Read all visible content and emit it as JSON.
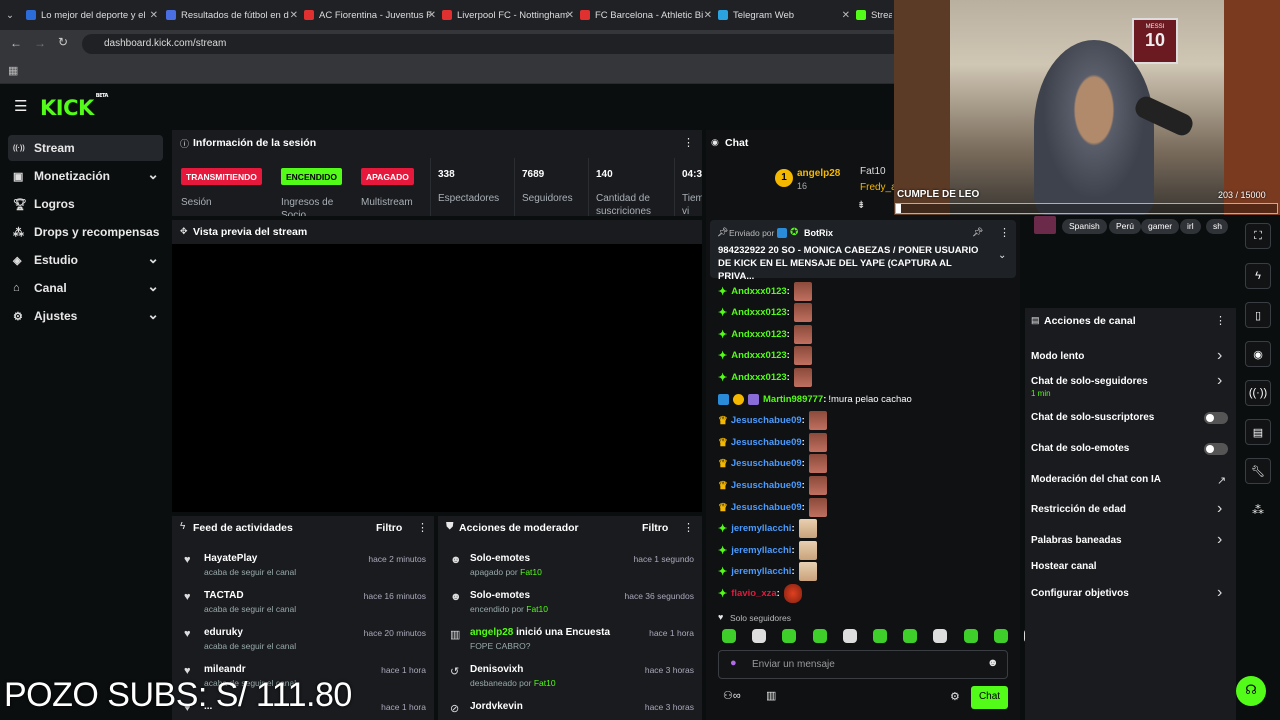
{
  "browser": {
    "tabs": [
      {
        "title": "Lo mejor del deporte y el",
        "color": "#2b6cd8"
      },
      {
        "title": "Resultados de fútbol en d",
        "color": "#4a6fe3"
      },
      {
        "title": "AC Fiorentina - Juventus F",
        "color": "#e03030"
      },
      {
        "title": "Liverpool FC - Nottingham",
        "color": "#e03030"
      },
      {
        "title": "FC Barcelona - Athletic Bi",
        "color": "#e03030"
      },
      {
        "title": "Telegram Web",
        "color": "#2aa3e0"
      },
      {
        "title": "Strea",
        "color": "#53fc18"
      }
    ],
    "url": "dashboard.kick.com/stream"
  },
  "logo": {
    "text": "KICK",
    "tag": "BETA"
  },
  "sidebar": {
    "items": [
      {
        "label": "Stream",
        "icon": "broadcast-icon",
        "active": true,
        "chevron": false
      },
      {
        "label": "Monetización",
        "icon": "monetization-icon",
        "chevron": true
      },
      {
        "label": "Logros",
        "icon": "trophy-icon",
        "chevron": false
      },
      {
        "label": "Drops y recompensas",
        "icon": "drops-icon",
        "chevron": false
      },
      {
        "label": "Estudio",
        "icon": "studio-icon",
        "chevron": true
      },
      {
        "label": "Canal",
        "icon": "channel-icon",
        "chevron": true
      },
      {
        "label": "Ajustes",
        "icon": "gear-icon",
        "chevron": true
      }
    ]
  },
  "session": {
    "title": "Información de la sesión",
    "badges": [
      {
        "text": "TRANSMITIENDO",
        "label": "Sesión",
        "color": "#e6183c"
      },
      {
        "text": "ENCENDIDO",
        "label": "Ingresos de Socio",
        "color": "#53fc18"
      },
      {
        "text": "APAGADO",
        "label": "Multistream",
        "color": "#e6183c"
      }
    ],
    "stats": [
      {
        "value": "338",
        "label": "Espectadores"
      },
      {
        "value": "7689",
        "label": "Seguidores"
      },
      {
        "value": "140",
        "label": "Cantidad de suscriciones"
      },
      {
        "value": "04:3",
        "label": "Tiem vi"
      }
    ]
  },
  "preview": {
    "title": "Vista previa del stream"
  },
  "activity": {
    "title": "Feed de actividades",
    "filter": "Filtro",
    "rows": [
      {
        "name": "HayatePlay",
        "sub": "acaba de seguir el canal",
        "time": "hace 2 minutos"
      },
      {
        "name": "TACTAD",
        "sub": "acaba de seguir el canal",
        "time": "hace 16 minutos"
      },
      {
        "name": "eduruky",
        "sub": "acaba de seguir el canal",
        "time": "hace 20 minutos"
      },
      {
        "name": "mileandr",
        "sub": "acaba de seguir el canal",
        "time": "hace 1 hora"
      },
      {
        "name": "...",
        "sub": "",
        "time": "hace 1 hora"
      }
    ]
  },
  "modactions": {
    "title": "Acciones de moderador",
    "filter": "Filtro",
    "rows": [
      {
        "name": "Solo-emotes",
        "sub": "apagado por",
        "by": "Fat10",
        "time": "hace 1 segundo"
      },
      {
        "name": "Solo-emotes",
        "sub": "encendido por",
        "by": "Fat10",
        "time": "hace 36 segundos"
      },
      {
        "name": "angelp28",
        "extra": " inició una Encuesta",
        "sub": "FOPE CABRO?",
        "by": "",
        "time": "hace 1 hora"
      },
      {
        "name": "Denisovixh",
        "sub": "desbaneado por",
        "by": "Fat10",
        "time": "hace 3 horas"
      },
      {
        "name": "Jordvkevin",
        "sub": "",
        "by": "",
        "time": "hace 3 horas"
      }
    ]
  },
  "chat": {
    "title": "Chat",
    "top": [
      {
        "name": "angelp28",
        "count": "16"
      },
      {
        "name": "Fat10"
      },
      {
        "name": "Fredy_a"
      }
    ],
    "pinned": {
      "label": "Enviado por",
      "by": "BotRix",
      "text": "984232922 20 SO - MONICA CABEZAS / PONER USUARIO DE KICK EN EL MENSAJE DEL YAPE (CAPTURA AL PRIVA..."
    },
    "messages": [
      {
        "user": "Andxxx0123",
        "color": "#53fc18",
        "text": "",
        "emote": "a"
      },
      {
        "user": "Andxxx0123",
        "color": "#53fc18",
        "text": "",
        "emote": "a"
      },
      {
        "user": "Andxxx0123",
        "color": "#53fc18",
        "text": "",
        "emote": "a"
      },
      {
        "user": "Andxxx0123",
        "color": "#53fc18",
        "text": "",
        "emote": "a"
      },
      {
        "user": "Andxxx0123",
        "color": "#53fc18",
        "text": "",
        "emote": "a"
      },
      {
        "user": "Martin989777",
        "color": "#53fc18",
        "text": "!mura pelao cachao",
        "emote": ""
      },
      {
        "user": "Jesuschabue09",
        "color": "#4a9bff",
        "text": "",
        "emote": "a"
      },
      {
        "user": "Jesuschabue09",
        "color": "#4a9bff",
        "text": "",
        "emote": "a"
      },
      {
        "user": "Jesuschabue09",
        "color": "#4a9bff",
        "text": "",
        "emote": "a"
      },
      {
        "user": "Jesuschabue09",
        "color": "#4a9bff",
        "text": "",
        "emote": "a"
      },
      {
        "user": "Jesuschabue09",
        "color": "#4a9bff",
        "text": "",
        "emote": "a"
      },
      {
        "user": "jeremyllacchi",
        "color": "#4a9bff",
        "text": "",
        "emote": "b"
      },
      {
        "user": "jeremyllacchi",
        "color": "#4a9bff",
        "text": "",
        "emote": "b"
      },
      {
        "user": "jeremyllacchi",
        "color": "#4a9bff",
        "text": "",
        "emote": "b"
      },
      {
        "user": "flavio_xza",
        "color": "#e6183c",
        "text": "",
        "emote": "c"
      }
    ],
    "mode": "Solo seguidores",
    "placeholder": "Enviar un mensaje",
    "send": "Chat"
  },
  "webcam": {
    "goal_title": "CUMPLE DE LEO",
    "goal_value": "203",
    "goal_target": "/ 15000",
    "goal_fraction": 0.0135,
    "jersey": "10",
    "jersey_name": "MESSI"
  },
  "tags": [
    "Spanish",
    "Perú",
    "gamer",
    "irl",
    "sh"
  ],
  "channel_actions": {
    "title": "Acciones de canal",
    "items": [
      {
        "label": "Modo lento",
        "control": "arrow"
      },
      {
        "label": "Chat de solo-seguidores",
        "sub": "1 min",
        "control": "arrow"
      },
      {
        "label": "Chat de solo-suscriptores",
        "control": "toggle"
      },
      {
        "label": "Chat de solo-emotes",
        "control": "toggle"
      },
      {
        "label": "Moderación del chat con IA",
        "control": "external"
      },
      {
        "label": "Restricción de edad",
        "control": "arrow"
      },
      {
        "label": "Palabras baneadas",
        "control": "arrow"
      },
      {
        "label": "Hostear canal",
        "control": "none"
      },
      {
        "label": "Configurar objetivos",
        "control": "arrow"
      }
    ]
  },
  "overlay": {
    "text": "POZO SUBS: S/ 111.80"
  }
}
